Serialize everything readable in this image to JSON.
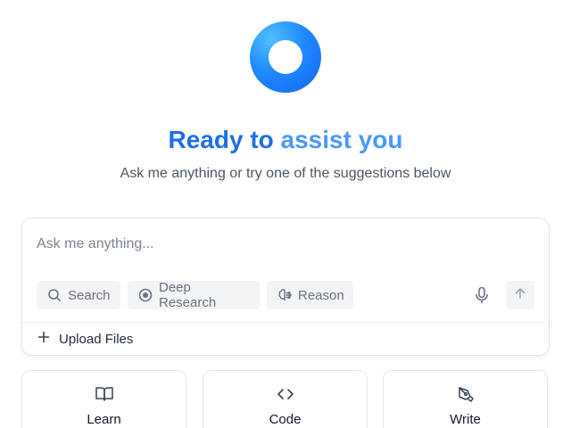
{
  "hero": {
    "title_part1": "Ready to",
    "title_part2": "assist you",
    "subtitle": "Ask me anything or try one of the suggestions below"
  },
  "composer": {
    "placeholder": "Ask me anything...",
    "chips": {
      "search": "Search",
      "deep_research": "Deep Research",
      "reason": "Reason"
    },
    "upload_label": "Upload Files"
  },
  "suggestions": [
    {
      "label": "Learn",
      "icon": "book-open-icon"
    },
    {
      "label": "Code",
      "icon": "code-icon"
    },
    {
      "label": "Write",
      "icon": "pen-tool-icon"
    }
  ],
  "colors": {
    "title_primary": "#1f6fe5",
    "title_accent": "#4a98ff",
    "logo_gradient": [
      "#4ec0ff",
      "#1e8bff",
      "#1565ee"
    ]
  }
}
